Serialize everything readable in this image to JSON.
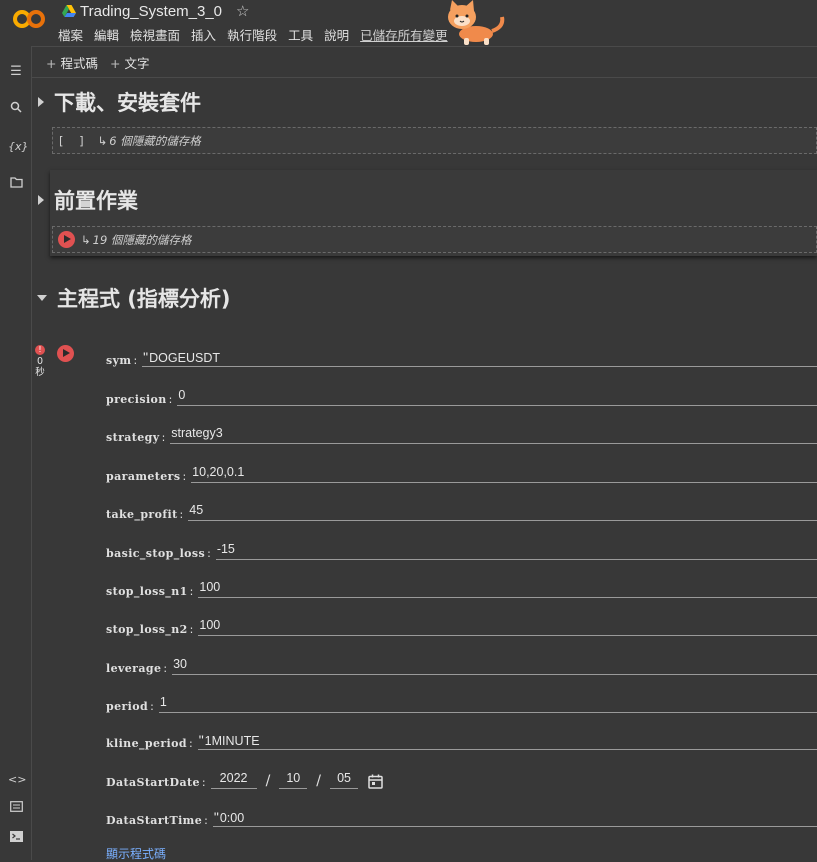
{
  "header": {
    "logo": "CO",
    "title": "Trading_System_3_0",
    "star_icon": "star-icon",
    "menu": [
      "檔案",
      "編輯",
      "檢視畫面",
      "插入",
      "執行階段",
      "工具",
      "說明"
    ],
    "saved_status": "已儲存所有變更"
  },
  "toolbar": {
    "add_code": "程式碼",
    "add_text": "文字"
  },
  "sections": [
    {
      "title": "下載、安裝套件",
      "hidden_cells": "6 個隱藏的儲存格"
    },
    {
      "title": "前置作業",
      "hidden_cells": "19 個隱藏的儲存格"
    },
    {
      "title": "主程式 (指標分析)"
    }
  ],
  "cell_status": {
    "error_badge": "!",
    "exec_time": "0",
    "unit": "秒"
  },
  "form": {
    "sym": {
      "label": "sym",
      "value": "DOGEUSDT"
    },
    "precision": {
      "label": "precision",
      "value": "0"
    },
    "strategy": {
      "label": "strategy",
      "value": "strategy3"
    },
    "parameters": {
      "label": "parameters",
      "value": "10,20,0.1"
    },
    "take_profit": {
      "label": "take_profit",
      "value": "45"
    },
    "basic_stop_loss": {
      "label": "basic_stop_loss",
      "value": "-15"
    },
    "stop_loss_n1": {
      "label": "stop_loss_n1",
      "value": "100"
    },
    "stop_loss_n2": {
      "label": "stop_loss_n2",
      "value": "100"
    },
    "leverage": {
      "label": "leverage",
      "value": "30"
    },
    "period": {
      "label": "period",
      "value": "1"
    },
    "kline_period": {
      "label": "kline_period",
      "value": "1MINUTE"
    },
    "DataStartDate": {
      "label": "DataStartDate",
      "year": "2022",
      "month": "10",
      "day": "05"
    },
    "DataStartTime": {
      "label": "DataStartTime",
      "value": "0:00"
    },
    "show_code": "顯示程式碼"
  },
  "colors": {
    "background": "#383838",
    "run_button": "#e05151",
    "link": "#7ab0ff",
    "logo_orange": "#f9ab00"
  }
}
